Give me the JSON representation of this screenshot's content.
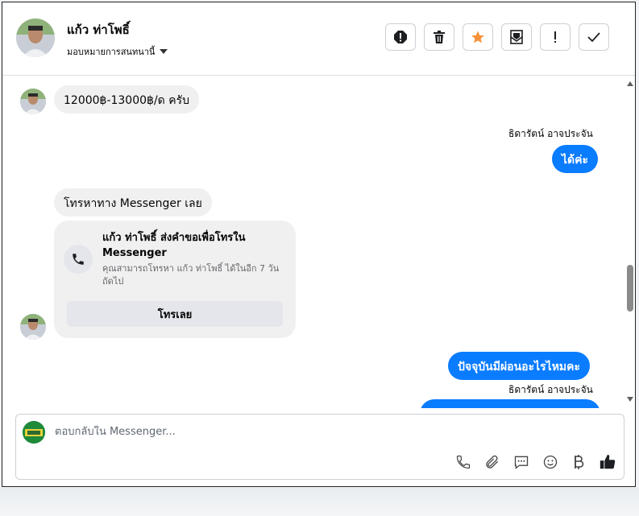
{
  "header": {
    "contact_name": "แก้ว ท่าโพธิ์",
    "assign_label": "มอบหมายการสนทนานี้",
    "toolbar": [
      "spam-icon",
      "trash-icon",
      "star-icon",
      "mark-unread-icon",
      "follow-up-icon",
      "done-icon"
    ]
  },
  "messages": {
    "m1": "12000฿-13000฿/ด ครับ",
    "sender1": "ธิดารัตน์ อาจประจัน",
    "m2": "ได้ค่ะ",
    "m3": "โทรหาทาง Messenger เลย",
    "card": {
      "title": "แก้ว ท่าโพธิ์ ส่งคำขอเพื่อโทรใน Messenger",
      "desc": "คุณสามารถโทรหา แก้ว ท่าโพธิ์ ได้ในอีก 7 วันถัดไป",
      "button": "โทรเลย"
    },
    "m4": "ปัจจุบันมีผ่อนอะไรไหมคะ",
    "sender2": "ธิดารัตน์ อาจประจัน"
  },
  "composer": {
    "placeholder": "ตอบกลับใน Messenger...",
    "tools": [
      "phone-icon",
      "paperclip-icon",
      "saved-reply-icon",
      "emoji-icon",
      "baht-icon",
      "thumbs-up-icon"
    ]
  },
  "colors": {
    "accent": "#0a7cff",
    "bubble_in": "#f0f0f0",
    "star": "#f7923a"
  }
}
